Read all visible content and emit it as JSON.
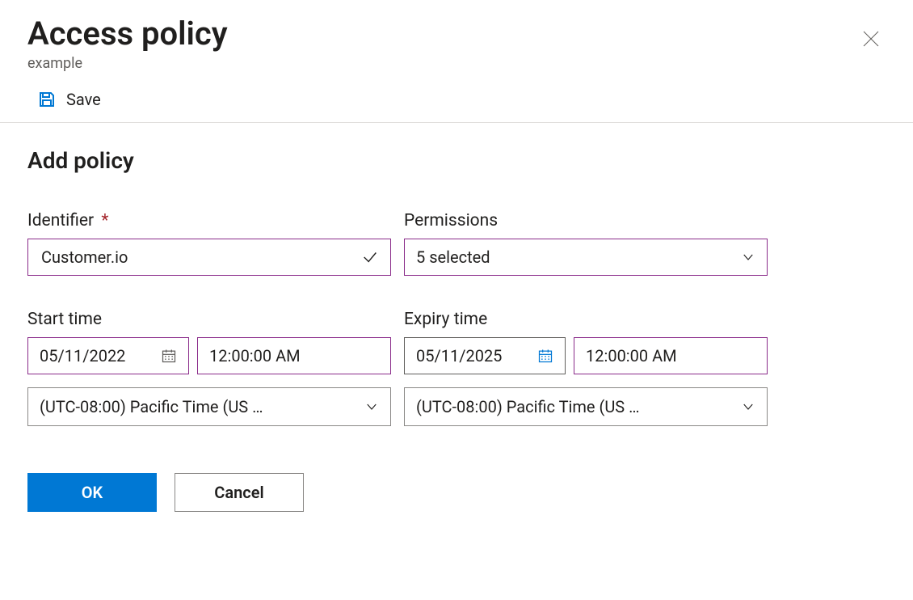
{
  "header": {
    "title": "Access policy",
    "subtitle": "example"
  },
  "toolbar": {
    "save_label": "Save"
  },
  "section": {
    "title": "Add policy"
  },
  "form": {
    "identifier": {
      "label": "Identifier",
      "required_marker": "*",
      "value": "Customer.io"
    },
    "permissions": {
      "label": "Permissions",
      "value": "5 selected"
    },
    "start": {
      "label": "Start time",
      "date": "05/11/2022",
      "time": "12:00:00 AM",
      "tz": "(UTC-08:00) Pacific Time (US …"
    },
    "expiry": {
      "label": "Expiry time",
      "date": "05/11/2025",
      "time": "12:00:00 AM",
      "tz": "(UTC-08:00) Pacific Time (US …"
    }
  },
  "footer": {
    "ok": "OK",
    "cancel": "Cancel"
  }
}
